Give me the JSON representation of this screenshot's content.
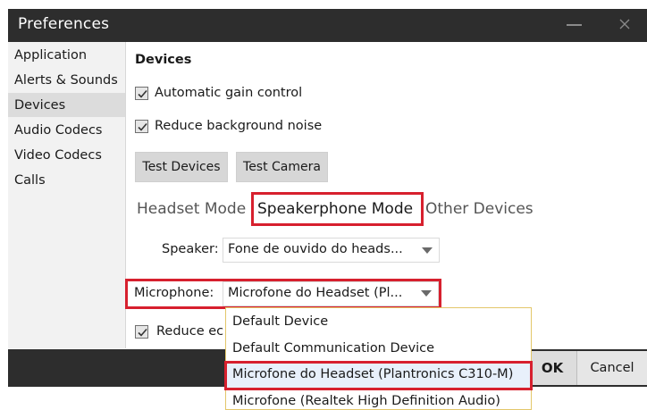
{
  "window": {
    "title": "Preferences"
  },
  "sidebar": {
    "items": [
      {
        "label": "Application"
      },
      {
        "label": "Alerts & Sounds"
      },
      {
        "label": "Devices"
      },
      {
        "label": "Audio Codecs"
      },
      {
        "label": "Video Codecs"
      },
      {
        "label": "Calls"
      }
    ],
    "selected": "Devices"
  },
  "devices": {
    "heading": "Devices",
    "agc_label": "Automatic gain control",
    "agc_checked": true,
    "noise_label": "Reduce background noise",
    "noise_checked": true,
    "test_devices_label": "Test Devices",
    "test_camera_label": "Test Camera",
    "tabs": [
      {
        "label": "Headset Mode"
      },
      {
        "label": "Speakerphone Mode"
      },
      {
        "label": "Other Devices"
      }
    ],
    "active_tab": "Speakerphone Mode",
    "speaker": {
      "label": "Speaker:",
      "value": "Fone de ouvido do heads..."
    },
    "microphone": {
      "label": "Microphone:",
      "value": "Microfone do Headset (Pl..."
    },
    "reduce_echo_label": "Reduce ec",
    "reduce_echo_checked": true
  },
  "dropdown": {
    "options": [
      {
        "label": "Default Device"
      },
      {
        "label": "Default Communication Device"
      },
      {
        "label": "Microfone do Headset (Plantronics C310-M)"
      },
      {
        "label": "Microfone (Realtek High Definition Audio)"
      }
    ],
    "highlighted": "Microfone do Headset (Plantronics C310-M)"
  },
  "footer": {
    "ok_label": "OK",
    "cancel_label": "Cancel"
  },
  "colors": {
    "highlight_red": "#d7202e",
    "titlebar": "#2d2d2d",
    "dropdown_border": "#e3c76a"
  },
  "icons": [
    "minimize-icon",
    "close-icon",
    "checkmark-icon",
    "dropdown-caret-icon"
  ]
}
